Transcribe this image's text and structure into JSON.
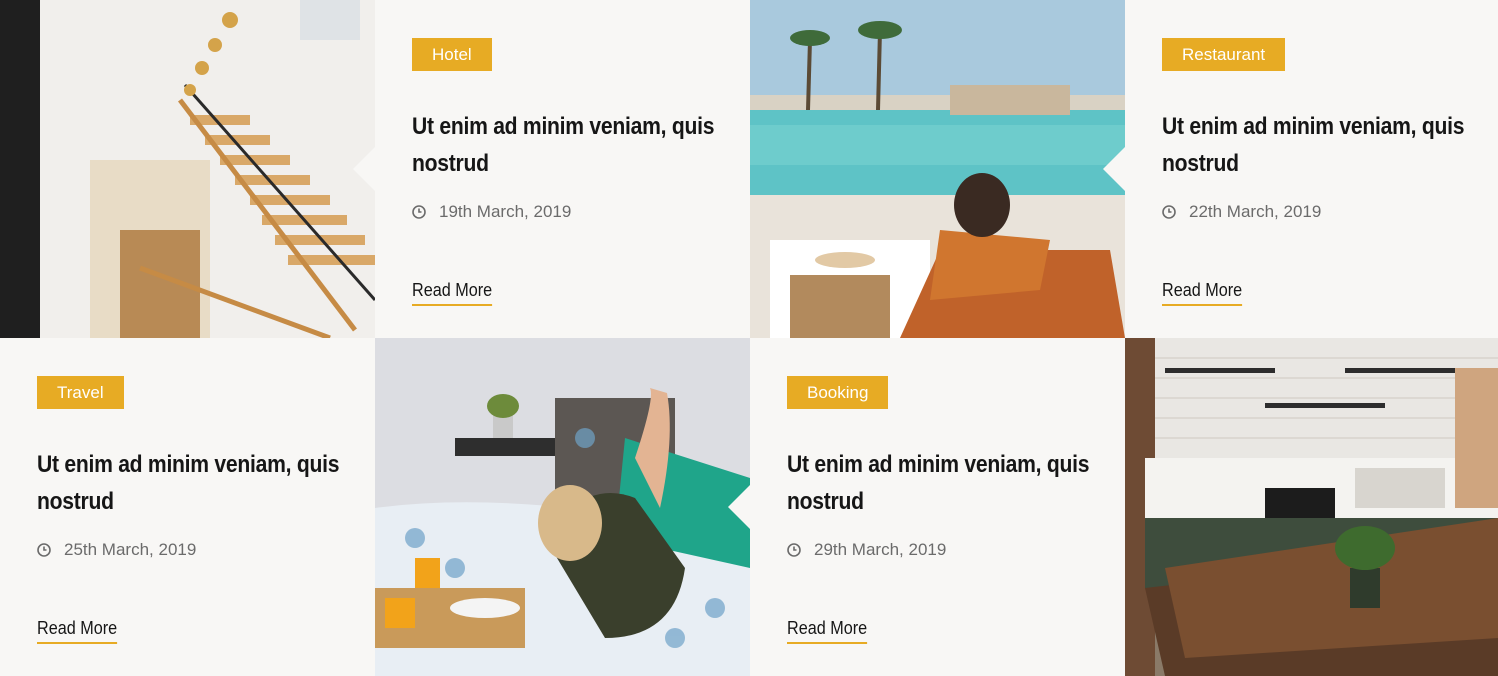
{
  "cards": [
    {
      "category": "Hotel",
      "title": "Ut enim ad minim veniam, quis nostrud",
      "date": "19th March, 2019",
      "read_more": "Read More"
    },
    {
      "category": "Restaurant",
      "title": "Ut enim ad minim veniam, quis nostrud",
      "date": "22th March, 2019",
      "read_more": "Read More"
    },
    {
      "category": "Travel",
      "title": "Ut enim ad minim veniam, quis nostrud",
      "date": "25th March, 2019",
      "read_more": "Read More"
    },
    {
      "category": "Booking",
      "title": "Ut enim ad minim veniam, quis nostrud",
      "date": "29th March, 2019",
      "read_more": "Read More"
    }
  ],
  "photos": [
    {
      "subject": "hotel-staircase"
    },
    {
      "subject": "poolside-lounger"
    },
    {
      "subject": "breakfast-in-bed"
    },
    {
      "subject": "cafe-interior"
    }
  ],
  "colors": {
    "accent": "#e7ab24",
    "card_bg": "#f8f7f5",
    "title": "#161616",
    "muted": "#6b6b6b"
  },
  "icons": {
    "date": "clock-icon"
  }
}
